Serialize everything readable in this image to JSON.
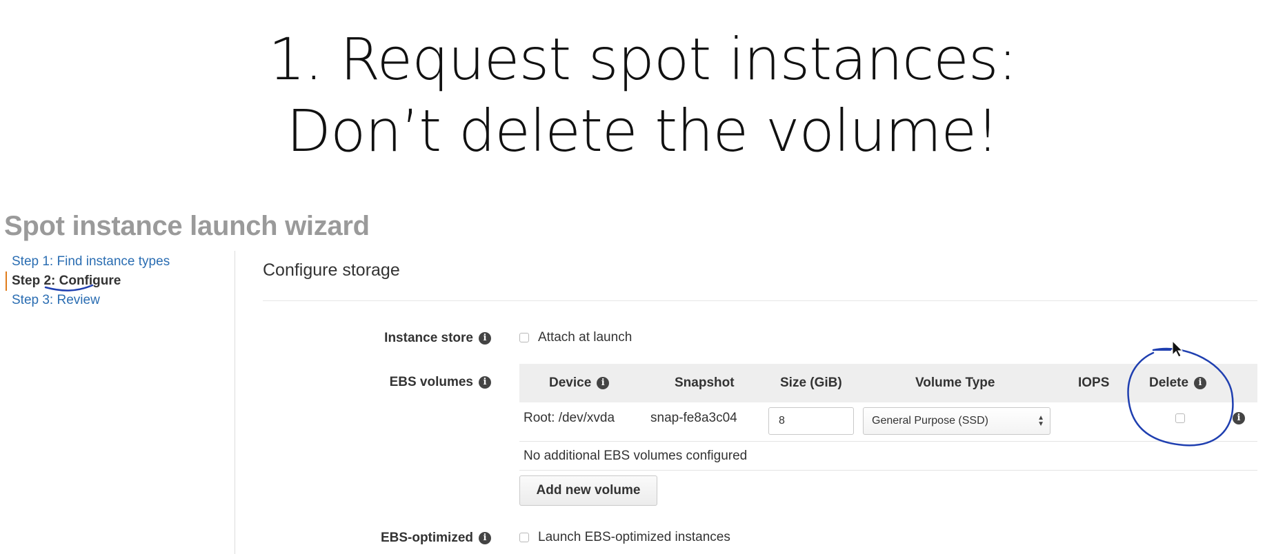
{
  "slide": {
    "title_line1": "1. Request spot instances:",
    "title_line2": "Don’t delete the volume!"
  },
  "wizard": {
    "title": "Spot instance launch wizard",
    "steps": [
      {
        "label": "Step 1: Find instance types"
      },
      {
        "label": "Step 2: Configure"
      },
      {
        "label": "Step 3: Review"
      }
    ],
    "active_step": 1
  },
  "configure_storage": {
    "title": "Configure storage",
    "instance_store": {
      "label": "Instance store",
      "checkbox_label": "Attach at launch",
      "checked": false
    },
    "ebs_volumes": {
      "label": "EBS volumes",
      "columns": [
        "Device",
        "Snapshot",
        "Size (GiB)",
        "Volume Type",
        "IOPS",
        "Delete"
      ],
      "rows": [
        {
          "device": "Root: /dev/xvda",
          "snapshot": "snap-fe8a3c04",
          "size": "8",
          "volume_type": "General Purpose (SSD)",
          "iops": "",
          "delete": false
        }
      ],
      "empty_message": "No additional EBS volumes configured",
      "add_button": "Add new volume"
    },
    "ebs_optimized": {
      "label": "EBS-optimized",
      "checkbox_label": "Launch EBS-optimized instances",
      "checked": false
    }
  },
  "colors": {
    "link": "#2a6db2",
    "active_step_marker": "#e07b19",
    "annotation_ink": "#1f3fb0",
    "table_header_bg": "#eeeeee"
  },
  "icons": {
    "info": "info-circle-icon",
    "cursor": "mouse-pointer-icon",
    "select_arrows": "updown-arrows-icon"
  }
}
